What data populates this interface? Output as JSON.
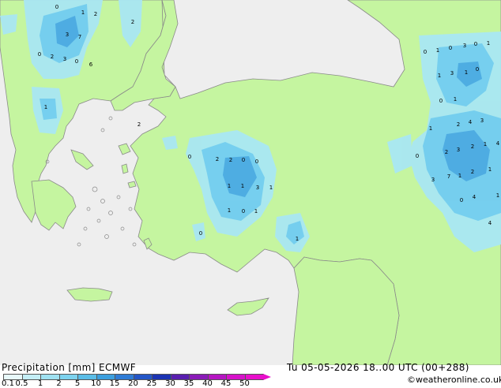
{
  "map_labels": [
    "0",
    "1",
    "2",
    "2",
    "3",
    "7",
    "0",
    "2",
    "3",
    "0",
    "6",
    "1",
    "2",
    "0",
    "2",
    "2",
    "0",
    "0",
    "1",
    "1",
    "3",
    "1",
    "1",
    "0",
    "1",
    "0",
    "1",
    "0",
    "1",
    "0",
    "3",
    "0",
    "1",
    "1",
    "3",
    "1",
    "0",
    "0",
    "1",
    "1",
    "2",
    "4",
    "3",
    "2",
    "3",
    "2",
    "1",
    "4",
    "0",
    "3",
    "7",
    "1",
    "2",
    "1",
    "0",
    "4",
    "1",
    "4"
  ],
  "footer": {
    "title": "Precipitation [mm]  ECMWF",
    "valid": "Tu 05-05-2026 18..00 UTC (00+288)",
    "credit": "©weatheronline.co.uk"
  },
  "colorbar": {
    "ticks": [
      "0.1",
      "0.5",
      "1",
      "2",
      "5",
      "10",
      "15",
      "20",
      "25",
      "30",
      "35",
      "40",
      "45",
      "50"
    ],
    "colors": [
      "#e8f9fb",
      "#c4eef6",
      "#9fe1f1",
      "#7dd2ee",
      "#5bbde7",
      "#3c9fde",
      "#2f7cd6",
      "#2456c7",
      "#1b33b3",
      "#5a1fb0",
      "#8a1bb8",
      "#b516c2",
      "#d612c9",
      "#e80fcb"
    ]
  },
  "colors": {
    "sea": "#eeeeee",
    "land": "#c5f5a0",
    "coast": "#8a8a8a"
  }
}
